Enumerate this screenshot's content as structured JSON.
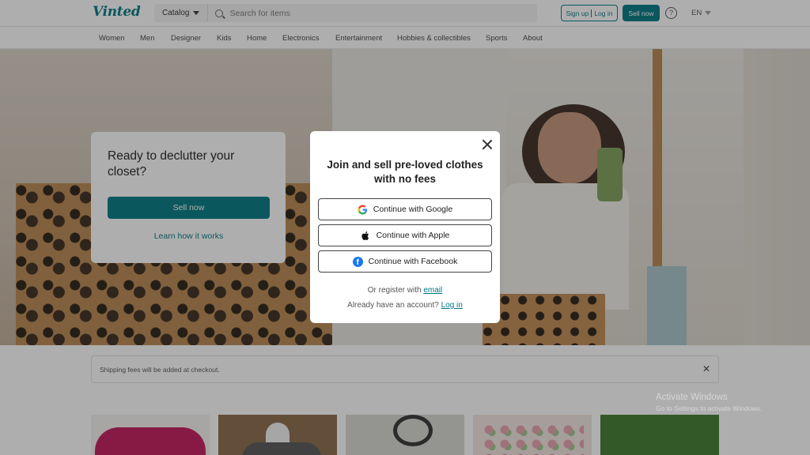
{
  "header": {
    "logo": "Vinted",
    "catalog_label": "Catalog",
    "search_placeholder": "Search for items",
    "signup_label": "Sign up",
    "login_label": "Log in",
    "sell_now_label": "Sell now",
    "help_symbol": "?",
    "language": "EN"
  },
  "nav": {
    "items": [
      "Women",
      "Men",
      "Designer",
      "Kids",
      "Home",
      "Electronics",
      "Entertainment",
      "Hobbies & collectibles",
      "Sports",
      "About"
    ]
  },
  "hero_card": {
    "title": "Ready to declutter your closet?",
    "sell_button": "Sell now",
    "learn_link": "Learn how it works"
  },
  "notice": {
    "text": "Shipping fees will be added at checkout.",
    "close_symbol": "✕"
  },
  "modal": {
    "title": "Join and sell pre-loved clothes with no fees",
    "google_label": "Continue with Google",
    "apple_label": "Continue with Apple",
    "facebook_label": "Continue with Facebook",
    "register_prefix": "Or register with",
    "register_link": "email",
    "login_prefix": "Already have an account?",
    "login_link": "Log in"
  },
  "watermark": {
    "title": "Activate Windows",
    "subtitle": "Go to Settings to activate Windows."
  },
  "colors": {
    "brand": "#007782",
    "facebook": "#1877f2",
    "overlay": "rgba(30,30,30,0.36)"
  },
  "icons": [
    "search-icon",
    "chevron-down-icon",
    "help-icon",
    "close-icon",
    "google-icon",
    "apple-icon",
    "facebook-icon"
  ]
}
